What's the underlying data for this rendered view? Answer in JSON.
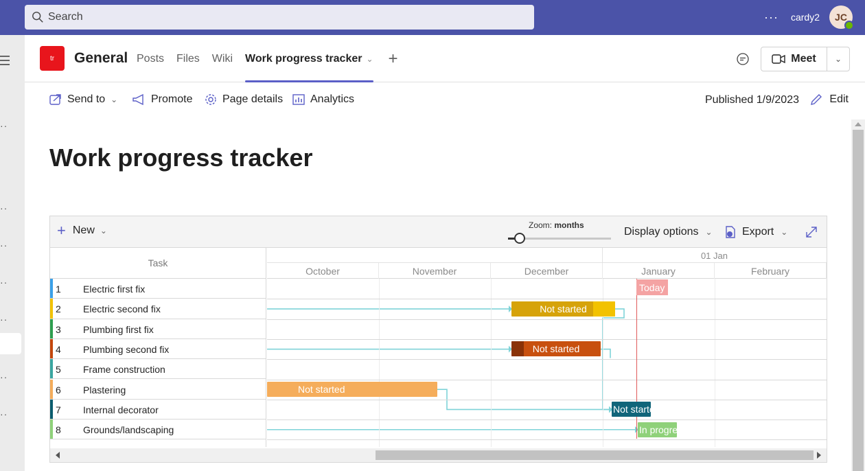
{
  "search": {
    "placeholder": "Search"
  },
  "user": {
    "name": "cardy2",
    "initials": "JC",
    "more": "···"
  },
  "channel": {
    "team_logo": "tr",
    "title": "General",
    "tabs": [
      {
        "label": "Posts"
      },
      {
        "label": "Files"
      },
      {
        "label": "Wiki"
      },
      {
        "label": "Work progress tracker",
        "active": true
      }
    ],
    "add_tab": "+",
    "meet_label": "Meet"
  },
  "page_toolbar": {
    "send_to": "Send to",
    "promote": "Promote",
    "page_details": "Page details",
    "analytics": "Analytics",
    "published": "Published 1/9/2023",
    "edit": "Edit"
  },
  "page": {
    "title": "Work progress tracker"
  },
  "gantt": {
    "new_label": "New",
    "zoom_prefix": "Zoom:",
    "zoom_value": "months",
    "display_options": "Display options",
    "export": "Export",
    "task_header": "Task",
    "year_label": "01 Jan",
    "months": [
      "October",
      "November",
      "December",
      "January",
      "February"
    ],
    "today_label": "Today",
    "tasks": [
      {
        "num": "1",
        "name": "Electric first fix",
        "color": "#3aa0e8"
      },
      {
        "num": "2",
        "name": "Electric second fix",
        "color": "#f2c200"
      },
      {
        "num": "3",
        "name": "Plumbing first fix",
        "color": "#2e9e4f"
      },
      {
        "num": "4",
        "name": "Plumbing second fix",
        "color": "#c4470c"
      },
      {
        "num": "5",
        "name": "Frame construction",
        "color": "#3aa6a0"
      },
      {
        "num": "6",
        "name": "Plastering",
        "color": "#f5ad5b"
      },
      {
        "num": "7",
        "name": "Internal decorator",
        "color": "#0b5d6e"
      },
      {
        "num": "8",
        "name": "Grounds/landscaping",
        "color": "#8fd17a"
      }
    ],
    "bars": [
      {
        "row": 1,
        "label": "Not started",
        "color": "#d6a30a",
        "progress_color": "#f2c200"
      },
      {
        "row": 3,
        "label": "Not started",
        "color": "#c8500f",
        "progress_color": "#8a3208"
      },
      {
        "row": 5,
        "label": "Not started",
        "color": "#f5ad5b"
      },
      {
        "row": 6,
        "label": "Not starte",
        "color": "#11657a"
      },
      {
        "row": 7,
        "label": "In progre",
        "color": "#8fd17a"
      }
    ]
  }
}
